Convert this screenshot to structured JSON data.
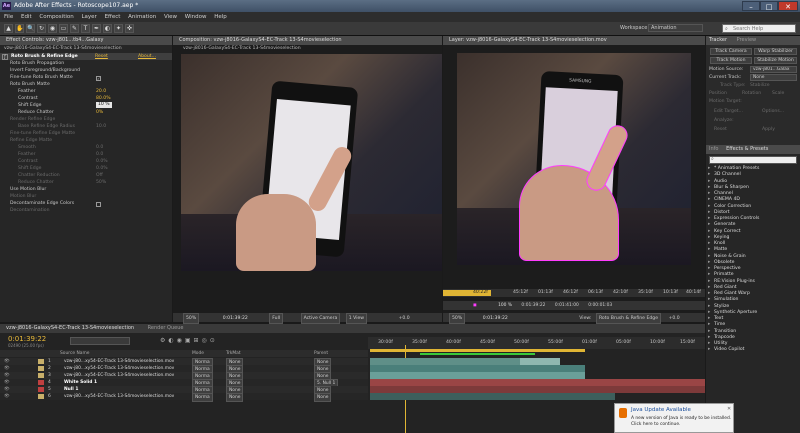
{
  "window": {
    "app_title": "Adobe After Effects - Rotoscope107.aep *",
    "minimize": "–",
    "maximize": "□",
    "close": "✕"
  },
  "menu": [
    "File",
    "Edit",
    "Composition",
    "Layer",
    "Effect",
    "Animation",
    "View",
    "Window",
    "Help"
  ],
  "toolbar": {
    "tools": [
      "▲",
      "✋",
      "🔍",
      "↻",
      "◉",
      "▭",
      "✎",
      "T",
      "✒",
      "◐",
      "✦",
      "✜"
    ],
    "workspace_label": "Workspace:",
    "workspace_value": "Animation",
    "search_placeholder": "Search Help"
  },
  "effect_controls": {
    "tab": "Effect Controls: vzw-j801...tb4...Galaxy",
    "layer_path": "vzw-j8016-GalaxyS4-EC-Track 13-S4movieselection",
    "effect_name": "Roto Brush & Refine Edge",
    "reset": "Reset",
    "about": "About...",
    "rows": [
      {
        "label": "Roto Brush Propagation",
        "value": "",
        "dim": false
      },
      {
        "label": "Invert Foreground/Background",
        "value": "",
        "dim": false
      },
      {
        "label": "Fine-tune Roto Brush Matte",
        "value": "",
        "dim": false
      },
      {
        "label": "Roto Brush Matte",
        "value": "",
        "dim": false
      },
      {
        "label": "Feather",
        "value": "20.0",
        "dim": false
      },
      {
        "label": "Contrast",
        "value": "80.0%",
        "dim": false
      },
      {
        "label": "Shift Edge",
        "value": "10 %",
        "dim": false
      },
      {
        "label": "Reduce Chatter",
        "value": "0%",
        "dim": false
      },
      {
        "label": "Render Refine Edge",
        "value": "",
        "dim": true
      },
      {
        "label": "Base Refine Edge Radius",
        "value": "10.0",
        "dim": true
      },
      {
        "label": "Fine-tune Refine Edge Matte",
        "value": "",
        "dim": true
      },
      {
        "label": "Refine Edge Matte",
        "value": "",
        "dim": true
      },
      {
        "label": "Smooth",
        "value": "0.0",
        "dim": true
      },
      {
        "label": "Feather",
        "value": "0.0",
        "dim": true
      },
      {
        "label": "Contrast",
        "value": "0.0%",
        "dim": true
      },
      {
        "label": "Shift Edge",
        "value": "0.0%",
        "dim": true
      },
      {
        "label": "Chatter Reduction",
        "value": "Off",
        "dim": true
      },
      {
        "label": "Reduce Chatter",
        "value": "50%",
        "dim": true
      },
      {
        "label": "Use Motion Blur",
        "value": "",
        "dim": false
      },
      {
        "label": "Motion Blur",
        "value": "",
        "dim": true
      },
      {
        "label": "Decontaminate Edge Colors",
        "value": "",
        "dim": false
      },
      {
        "label": "Decontamination",
        "value": "",
        "dim": true
      }
    ]
  },
  "composition": {
    "tab": "Composition: vzw-j8016-GalaxyS4-EC-Track 13-S4movieselection",
    "subtab": "vzw-j8016-GalaxyS4-EC-Track 13-S4movieselection",
    "zoom": "50%",
    "timecode": "0:01:39:22",
    "resolution": "Full",
    "camera": "Active Camera",
    "view": "1 View",
    "offset": "+0.0"
  },
  "layer_panel": {
    "tab": "Layer: vzw-j8016-GalaxyS4-EC-Track 13-S4movieselection.mov",
    "phone_brand": "SAMSUNG",
    "ruler": [
      "40:22f",
      "45:12f",
      "01:13f",
      "46:12f",
      "06:13f",
      "42:10f",
      "35:10f",
      "10:13f",
      "40:14f"
    ],
    "zoom": "50%",
    "in_time": "0:01:39:22",
    "duration_time": "0:01:41:00",
    "out_time": "0:00:01:03",
    "view_label": "View:",
    "view_value": "Roto Brush & Refine Edge",
    "offset": "+0.0",
    "zoom_percent": "100 %"
  },
  "tracker": {
    "tabs": [
      "Tracker",
      "Preview"
    ],
    "buttons": [
      "Track Camera",
      "Warp Stabilizer",
      "Track Motion",
      "Stabilize Motion"
    ],
    "motion_source_label": "Motion Source:",
    "motion_source_value": "vzw-j801...Galax",
    "current_track_label": "Current Track:",
    "current_track_value": "None",
    "track_type_label": "Track Type:",
    "track_type_value": "Stabilize",
    "options": [
      "Position",
      "Rotation",
      "Scale"
    ],
    "motion_target": "Motion Target:",
    "edit_target": "Edit Target...",
    "options_btn": "Options...",
    "analyze": "Analyze:",
    "reset": "Reset",
    "apply": "Apply"
  },
  "effects_presets": {
    "tabs": [
      "Info",
      "Effects & Presets"
    ],
    "search_value": "",
    "items": [
      "* Animation Presets",
      "3D Channel",
      "Audio",
      "Blur & Sharpen",
      "Channel",
      "CINEMA 4D",
      "Color Correction",
      "Distort",
      "Expression Controls",
      "Generate",
      "Key Correct",
      "Keying",
      "Knoll",
      "Matte",
      "Noise & Grain",
      "Obsolete",
      "Perspective",
      "Primatte",
      "RE:Vision Plug-ins",
      "Red Giant",
      "Red Giant Warp",
      "Simulation",
      "Stylize",
      "Synthetic Aperture",
      "Text",
      "Time",
      "Transition",
      "Trapcode",
      "Utility",
      "Video Copilot"
    ]
  },
  "timeline": {
    "tabs": [
      "vzw-j8016-GalaxyS4-EC-Track 13-S4movieselection",
      "Render Queue"
    ],
    "timecode": "0:01:39:22",
    "timecode_sub": "02490 (25.00 fps)",
    "search_placeholder": "",
    "col_source": "Source Name",
    "col_mode": "Mode",
    "col_trkmat": "TrkMat",
    "col_parent": "Parent",
    "ruler": [
      "30:00f",
      "35:00f",
      "40:00f",
      "45:00f",
      "50:00f",
      "55:00f",
      "01:00f",
      "05:00f",
      "10:00f",
      "15:00f"
    ],
    "layers": [
      {
        "num": "1",
        "name": "vzw-j80...xy54-EC-Track 13-S4movieselection.mov",
        "mode": "Norma",
        "trkmat": "None",
        "parent": "None",
        "color": "#c9b06a"
      },
      {
        "num": "2",
        "name": "vzw-j80...xy54-EC-Track 13-S4movieselection.mov",
        "mode": "Norma",
        "trkmat": "None",
        "parent": "None",
        "color": "#c9b06a"
      },
      {
        "num": "3",
        "name": "vzw-j80...xy54-EC-Track 13-S4movieselection.mov",
        "mode": "Norma",
        "trkmat": "None",
        "parent": "None",
        "color": "#c9b06a"
      },
      {
        "num": "4",
        "name": "White Solid 1",
        "mode": "Norma",
        "trkmat": "None",
        "parent": "5. Null 1",
        "color": "#c04040"
      },
      {
        "num": "5",
        "name": "Null 1",
        "mode": "Norma",
        "trkmat": "None",
        "parent": "None",
        "color": "#c04040"
      },
      {
        "num": "6",
        "name": "vzw-j80...xy54-EC-Track 13-S4movieselection.mov",
        "mode": "Norma",
        "trkmat": "None",
        "parent": "None",
        "color": "#c9b06a"
      }
    ]
  },
  "java_popup": {
    "title": "Java Update Available",
    "line1": "A new version of Java is ready to be installed.",
    "line2": "Click here to continue."
  }
}
